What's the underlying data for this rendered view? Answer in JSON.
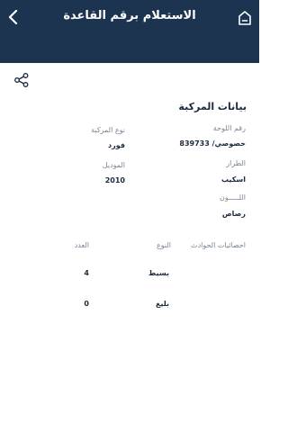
{
  "header": {
    "title": "الاستعلام برقم القاعدة",
    "color": "#1d3450"
  },
  "vehicle": {
    "section_title": "بيانات المركبة",
    "plate_label": "رقم اللوحة",
    "plate_value": "خصوصي/ 839733",
    "make_label": "نوع المركبة",
    "make_value": "فورد",
    "model_label": "الطراز",
    "model_value": "اسكيب",
    "year_label": "الموديل",
    "year_value": "2010",
    "color_label": "اللـــــون",
    "color_value": "رصاص"
  },
  "accidents": {
    "label": "احصائيات الحوادث",
    "columns": {
      "type": "النوع",
      "count": "العدد"
    },
    "rows": [
      {
        "type": "بسيط",
        "count": "4"
      },
      {
        "type": "بليغ",
        "count": "0"
      }
    ]
  }
}
